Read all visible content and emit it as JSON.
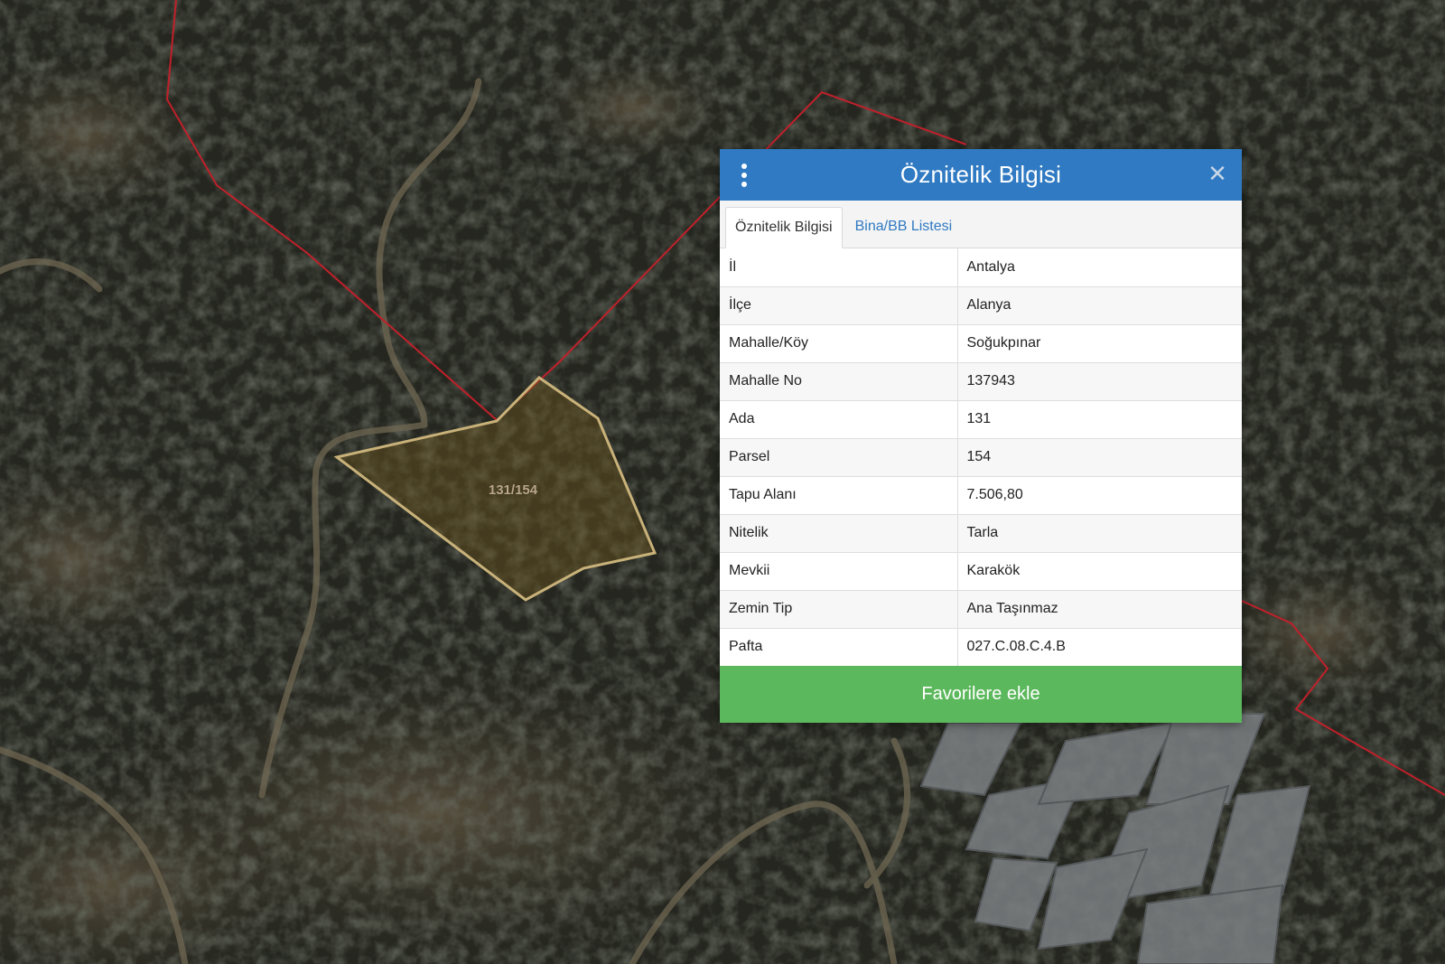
{
  "map": {
    "parcel_label": "131/154",
    "colors": {
      "parcel_outline": "#c9b27a",
      "boundary": "#c0202a"
    }
  },
  "panel": {
    "title": "Öznitelik Bilgisi",
    "menu_icon": "vertical-ellipsis-icon",
    "close_icon": "close-icon",
    "tabs": [
      {
        "label": "Öznitelik Bilgisi",
        "active": true
      },
      {
        "label": "Bina/BB Listesi",
        "active": false
      }
    ],
    "rows": [
      {
        "key": "İl",
        "value": "Antalya"
      },
      {
        "key": "İlçe",
        "value": "Alanya"
      },
      {
        "key": "Mahalle/Köy",
        "value": "Soğukpınar"
      },
      {
        "key": "Mahalle No",
        "value": "137943"
      },
      {
        "key": "Ada",
        "value": "131"
      },
      {
        "key": "Parsel",
        "value": "154"
      },
      {
        "key": "Tapu Alanı",
        "value": "7.506,80"
      },
      {
        "key": "Nitelik",
        "value": "Tarla"
      },
      {
        "key": "Mevkii",
        "value": "Karakök"
      },
      {
        "key": "Zemin Tip",
        "value": "Ana Taşınmaz"
      },
      {
        "key": "Pafta",
        "value": "027.C.08.C.4.B"
      }
    ],
    "favorite_button": "Favorilere ekle",
    "colors": {
      "header": "#2f7ac2",
      "button": "#5cb85c",
      "tab_link": "#2f7ac2"
    }
  }
}
